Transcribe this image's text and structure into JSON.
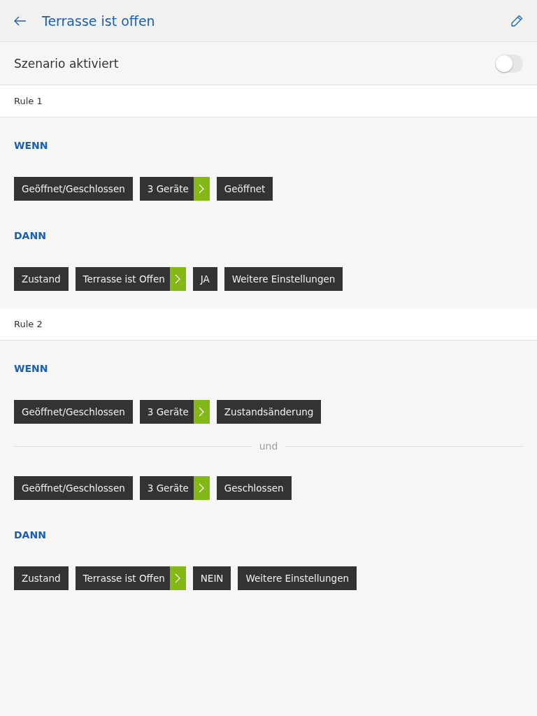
{
  "header": {
    "title": "Terrasse ist offen"
  },
  "scenario": {
    "label": "Szenario aktiviert",
    "on": false
  },
  "rules": [
    {
      "title": "Rule 1",
      "sections": [
        {
          "heading": "WENN",
          "rows": [
            {
              "kind": "chips",
              "chips": [
                {
                  "kind": "plain",
                  "label": "Geöffnet/Geschlossen"
                },
                {
                  "kind": "expand",
                  "label": "3 Geräte"
                },
                {
                  "kind": "plain",
                  "label": "Geöffnet"
                }
              ]
            }
          ]
        },
        {
          "heading": "DANN",
          "rows": [
            {
              "kind": "chips",
              "chips": [
                {
                  "kind": "plain",
                  "label": "Zustand"
                },
                {
                  "kind": "expand",
                  "label": "Terrasse ist Offen"
                },
                {
                  "kind": "plain",
                  "label": "JA"
                },
                {
                  "kind": "plain",
                  "label": "Weitere Einstellungen"
                }
              ]
            }
          ]
        }
      ]
    },
    {
      "title": "Rule 2",
      "sections": [
        {
          "heading": "WENN",
          "rows": [
            {
              "kind": "chips",
              "chips": [
                {
                  "kind": "plain",
                  "label": "Geöffnet/Geschlossen"
                },
                {
                  "kind": "expand",
                  "label": "3 Geräte"
                },
                {
                  "kind": "plain",
                  "label": "Zustandsänderung"
                }
              ]
            },
            {
              "kind": "divider",
              "label": "und"
            },
            {
              "kind": "chips",
              "chips": [
                {
                  "kind": "plain",
                  "label": "Geöffnet/Geschlossen"
                },
                {
                  "kind": "expand",
                  "label": "3 Geräte"
                },
                {
                  "kind": "plain",
                  "label": "Geschlossen"
                }
              ]
            }
          ]
        },
        {
          "heading": "DANN",
          "rows": [
            {
              "kind": "chips",
              "chips": [
                {
                  "kind": "plain",
                  "label": "Zustand"
                },
                {
                  "kind": "expand",
                  "label": "Terrasse ist Offen"
                },
                {
                  "kind": "plain",
                  "label": "NEIN"
                },
                {
                  "kind": "plain",
                  "label": "Weitere Einstellungen"
                }
              ]
            }
          ]
        }
      ]
    }
  ]
}
